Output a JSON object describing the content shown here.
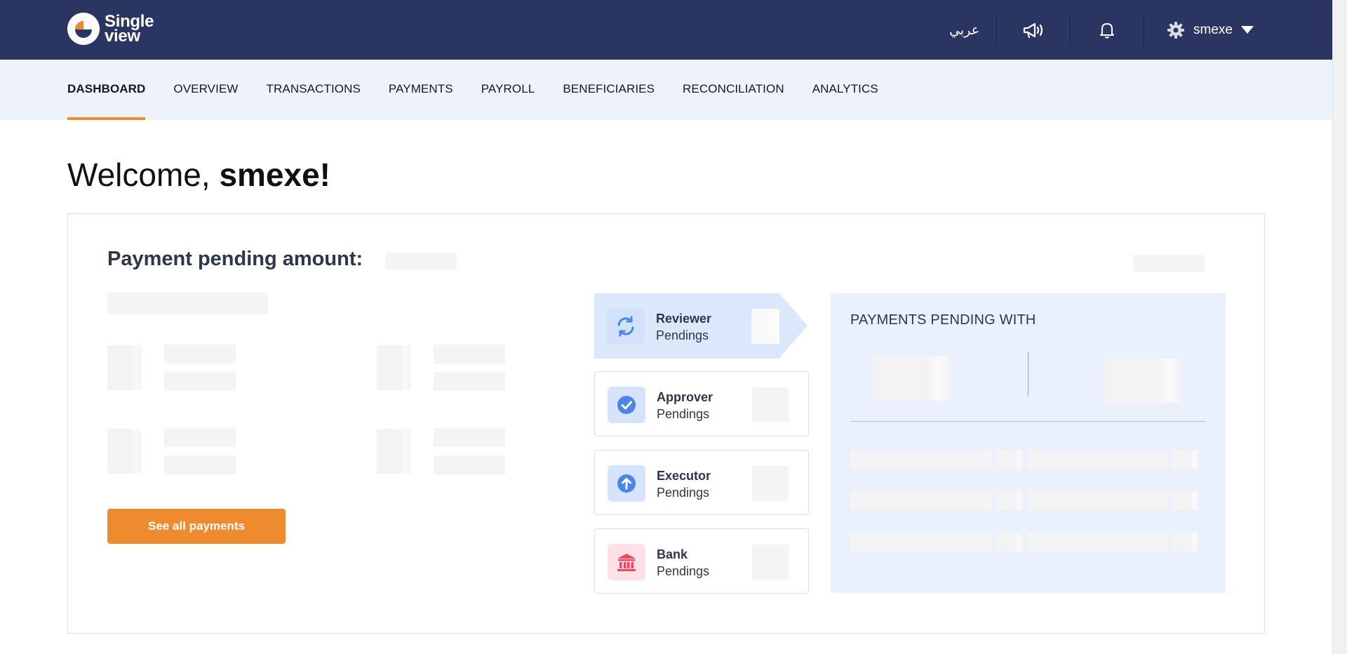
{
  "header": {
    "logo_line1": "Single",
    "logo_line2": "view",
    "language_label": "عربي",
    "user_name": "smexe",
    "icons": [
      "megaphone-icon",
      "bell-icon",
      "gear-icon",
      "caret-down-icon"
    ]
  },
  "nav": {
    "items": [
      {
        "label": "DASHBOARD",
        "active": true
      },
      {
        "label": "OVERVIEW"
      },
      {
        "label": "TRANSACTIONS"
      },
      {
        "label": "PAYMENTS"
      },
      {
        "label": "PAYROLL"
      },
      {
        "label": "BENEFICIARIES"
      },
      {
        "label": "RECONCILIATION"
      },
      {
        "label": "ANALYTICS"
      }
    ]
  },
  "welcome": {
    "greeting": "Welcome, ",
    "user": "smexe!"
  },
  "payments_card": {
    "pending_amount_label": "Payment pending amount:",
    "see_all_button": "See all payments",
    "pendings": [
      {
        "title": "Reviewer",
        "subtitle": "Pendings",
        "icon": "refresh-icon",
        "color": "#4a86e8"
      },
      {
        "title": "Approver",
        "subtitle": "Pendings",
        "icon": "check-circle-icon",
        "color": "#4a86e8"
      },
      {
        "title": "Executor",
        "subtitle": "Pendings",
        "icon": "arrow-up-circle-icon",
        "color": "#4a86e8"
      },
      {
        "title": "Bank",
        "subtitle": "Pendings",
        "icon": "bank-icon",
        "color": "#f04760"
      }
    ],
    "pending_with_title": "PAYMENTS PENDING WITH"
  },
  "colors": {
    "header_bg": "#2b3561",
    "nav_bg": "#eef2fb",
    "accent": "#ee8b2f",
    "panel_bg": "#eaf1fd"
  }
}
